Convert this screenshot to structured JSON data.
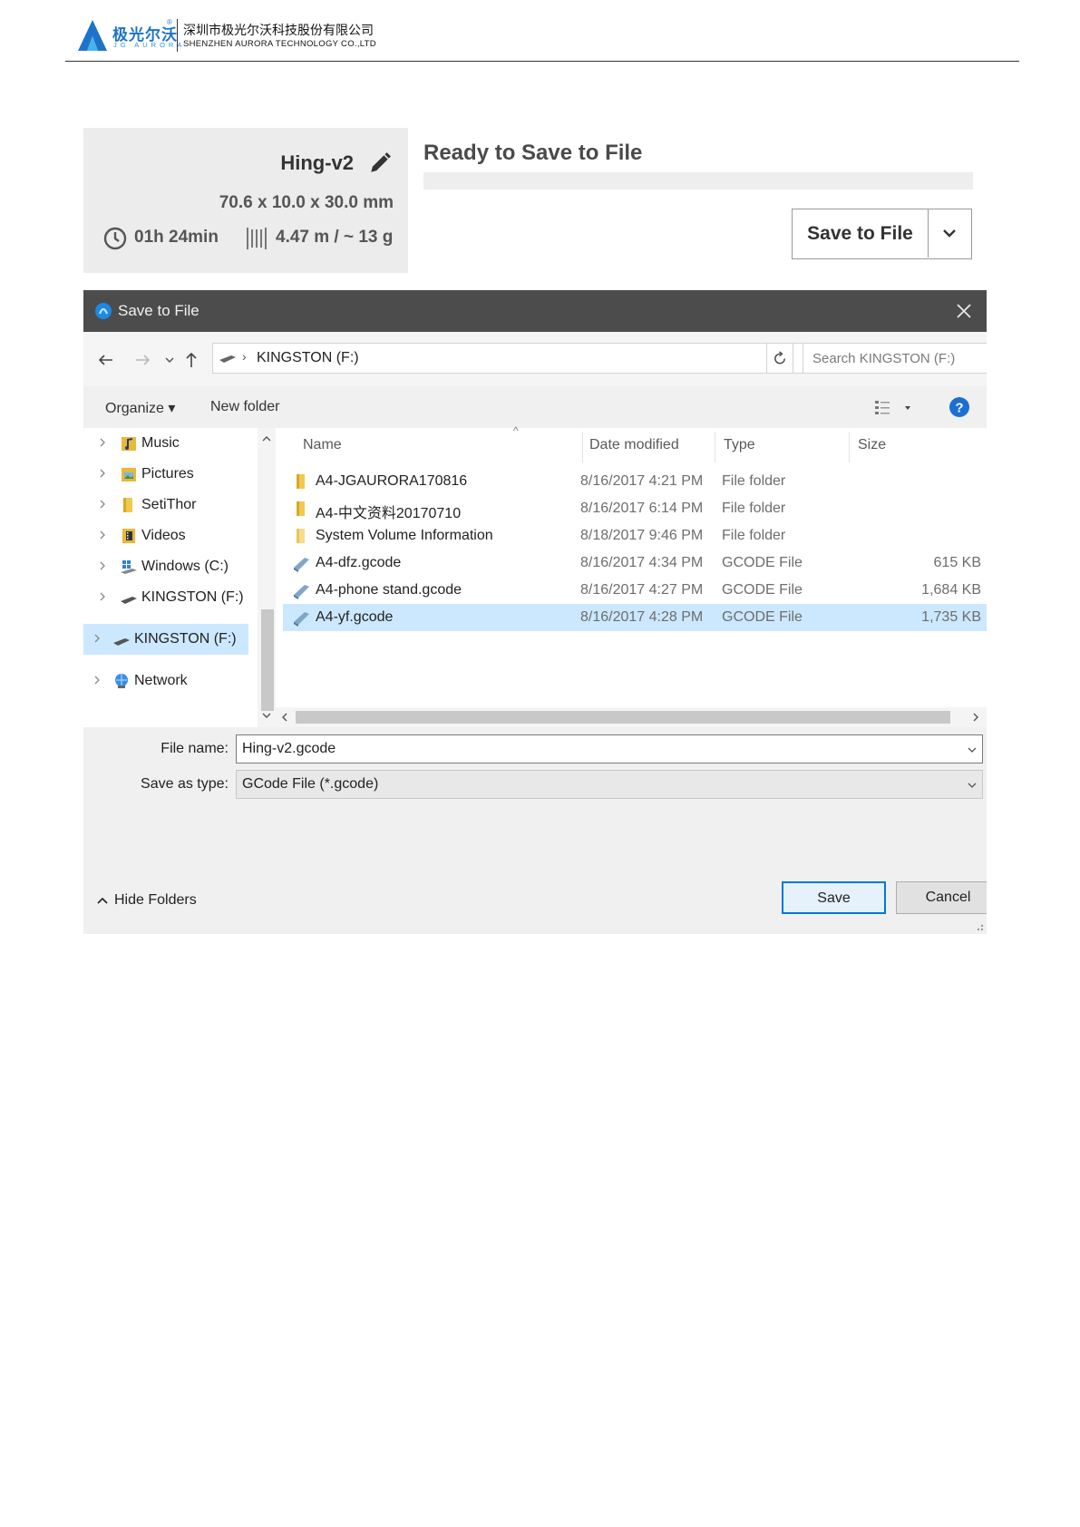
{
  "header": {
    "brand_cn": "极光尔沃",
    "brand_en": "JG AURORA",
    "registered_mark": "®",
    "company_cn": "深圳市极光尔沃科技股份有限公司",
    "company_en": "SHENZHEN AURORA TECHNOLOGY CO.,LTD"
  },
  "slicer": {
    "model_name": "Hing-v2",
    "dimensions": "70.6 x 10.0 x 30.0 mm",
    "print_time": "01h 24min",
    "filament": "4.47 m / ~ 13 g",
    "status_title": "Ready to Save to File",
    "save_button_label": "Save to File"
  },
  "dialog": {
    "title": "Save to File",
    "address": {
      "location": "KINGSTON (F:)"
    },
    "search_placeholder": "Search KINGSTON (F:)",
    "toolbar": {
      "organize_label": "Organize ▾",
      "new_folder_label": "New folder"
    },
    "nav_items": [
      {
        "label": "Music",
        "icon": "music-folder-icon"
      },
      {
        "label": "Pictures",
        "icon": "pictures-folder-icon"
      },
      {
        "label": "SetiThor",
        "icon": "folder-icon"
      },
      {
        "label": "Videos",
        "icon": "videos-folder-icon"
      },
      {
        "label": "Windows (C:)",
        "icon": "windows-drive-icon"
      },
      {
        "label": "KINGSTON (F:)",
        "icon": "usb-drive-icon"
      },
      {
        "label": "KINGSTON (F:)",
        "icon": "usb-drive-icon",
        "selected": true
      },
      {
        "label": "Network",
        "icon": "network-icon"
      }
    ],
    "columns": {
      "name": "Name",
      "date": "Date modified",
      "type": "Type",
      "size": "Size"
    },
    "files": [
      {
        "name": "A4-JGAURORA170816",
        "date": "8/16/2017 4:21 PM",
        "type": "File folder",
        "size": "",
        "icon": "folder-icon"
      },
      {
        "name": "A4-中文资料20170710",
        "date": "8/16/2017 6:14 PM",
        "type": "File folder",
        "size": "",
        "icon": "folder-icon"
      },
      {
        "name": "System Volume Information",
        "date": "8/18/2017 9:46 PM",
        "type": "File folder",
        "size": "",
        "icon": "folder-icon"
      },
      {
        "name": "A4-dfz.gcode",
        "date": "8/16/2017 4:34 PM",
        "type": "GCODE File",
        "size": "615 KB",
        "icon": "gcode-file-icon"
      },
      {
        "name": "A4-phone stand.gcode",
        "date": "8/16/2017 4:27 PM",
        "type": "GCODE File",
        "size": "1,684 KB",
        "icon": "gcode-file-icon"
      },
      {
        "name": "A4-yf.gcode",
        "date": "8/16/2017 4:28 PM",
        "type": "GCODE File",
        "size": "1,735 KB",
        "icon": "gcode-file-icon",
        "selected": true
      }
    ],
    "file_name_label": "File name:",
    "file_name_value": "Hing-v2.gcode",
    "save_type_label": "Save as type:",
    "save_type_value": "GCode File (*.gcode)",
    "hide_folders_label": "Hide Folders",
    "save_label": "Save",
    "cancel_label": "Cancel"
  },
  "colors": {
    "brand_blue": "#1e73c8",
    "selection": "#cce8ff",
    "accent": "#0078d7",
    "titlebar": "#4c4c4c"
  }
}
